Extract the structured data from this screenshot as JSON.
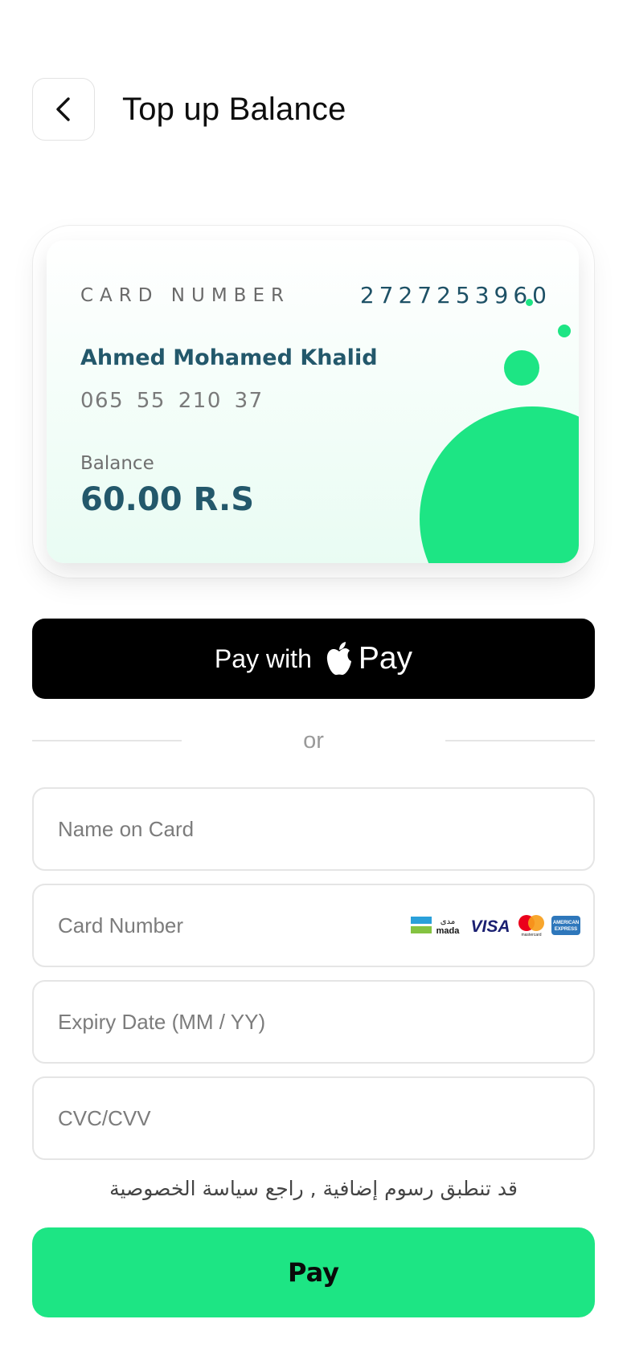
{
  "header": {
    "title": "Top up Balance",
    "back_icon": "chevron-left-icon"
  },
  "card": {
    "number_label": "CARD NUMBER",
    "number_value": "2727253960",
    "holder_name": "Ahmed Mohamed Khalid",
    "id_number": "065 55 210 37",
    "balance_label": "Balance",
    "balance_value": "60.00 R.S",
    "accent_color": "#1de584"
  },
  "apple_pay": {
    "prefix": "Pay with",
    "brand_icon": "apple-logo-icon",
    "suffix": "Pay"
  },
  "divider": {
    "label": "or"
  },
  "form": {
    "name_placeholder": "Name on Card",
    "card_number_placeholder": "Card Number",
    "expiry_placeholder": "Expiry Date (MM / YY)",
    "cvc_placeholder": "CVC/CVV",
    "card_logos": {
      "mada_ar": "مدى",
      "mada_en": "mada",
      "visa": "VISA",
      "mastercard": "mastercard",
      "amex_line1": "AMERICAN",
      "amex_line2": "EXPRESS"
    }
  },
  "notice": "قد تنطبق رسوم إضافية , راجع سياسة الخصوصية",
  "pay_button": {
    "label": "Pay",
    "color": "#1de584"
  }
}
